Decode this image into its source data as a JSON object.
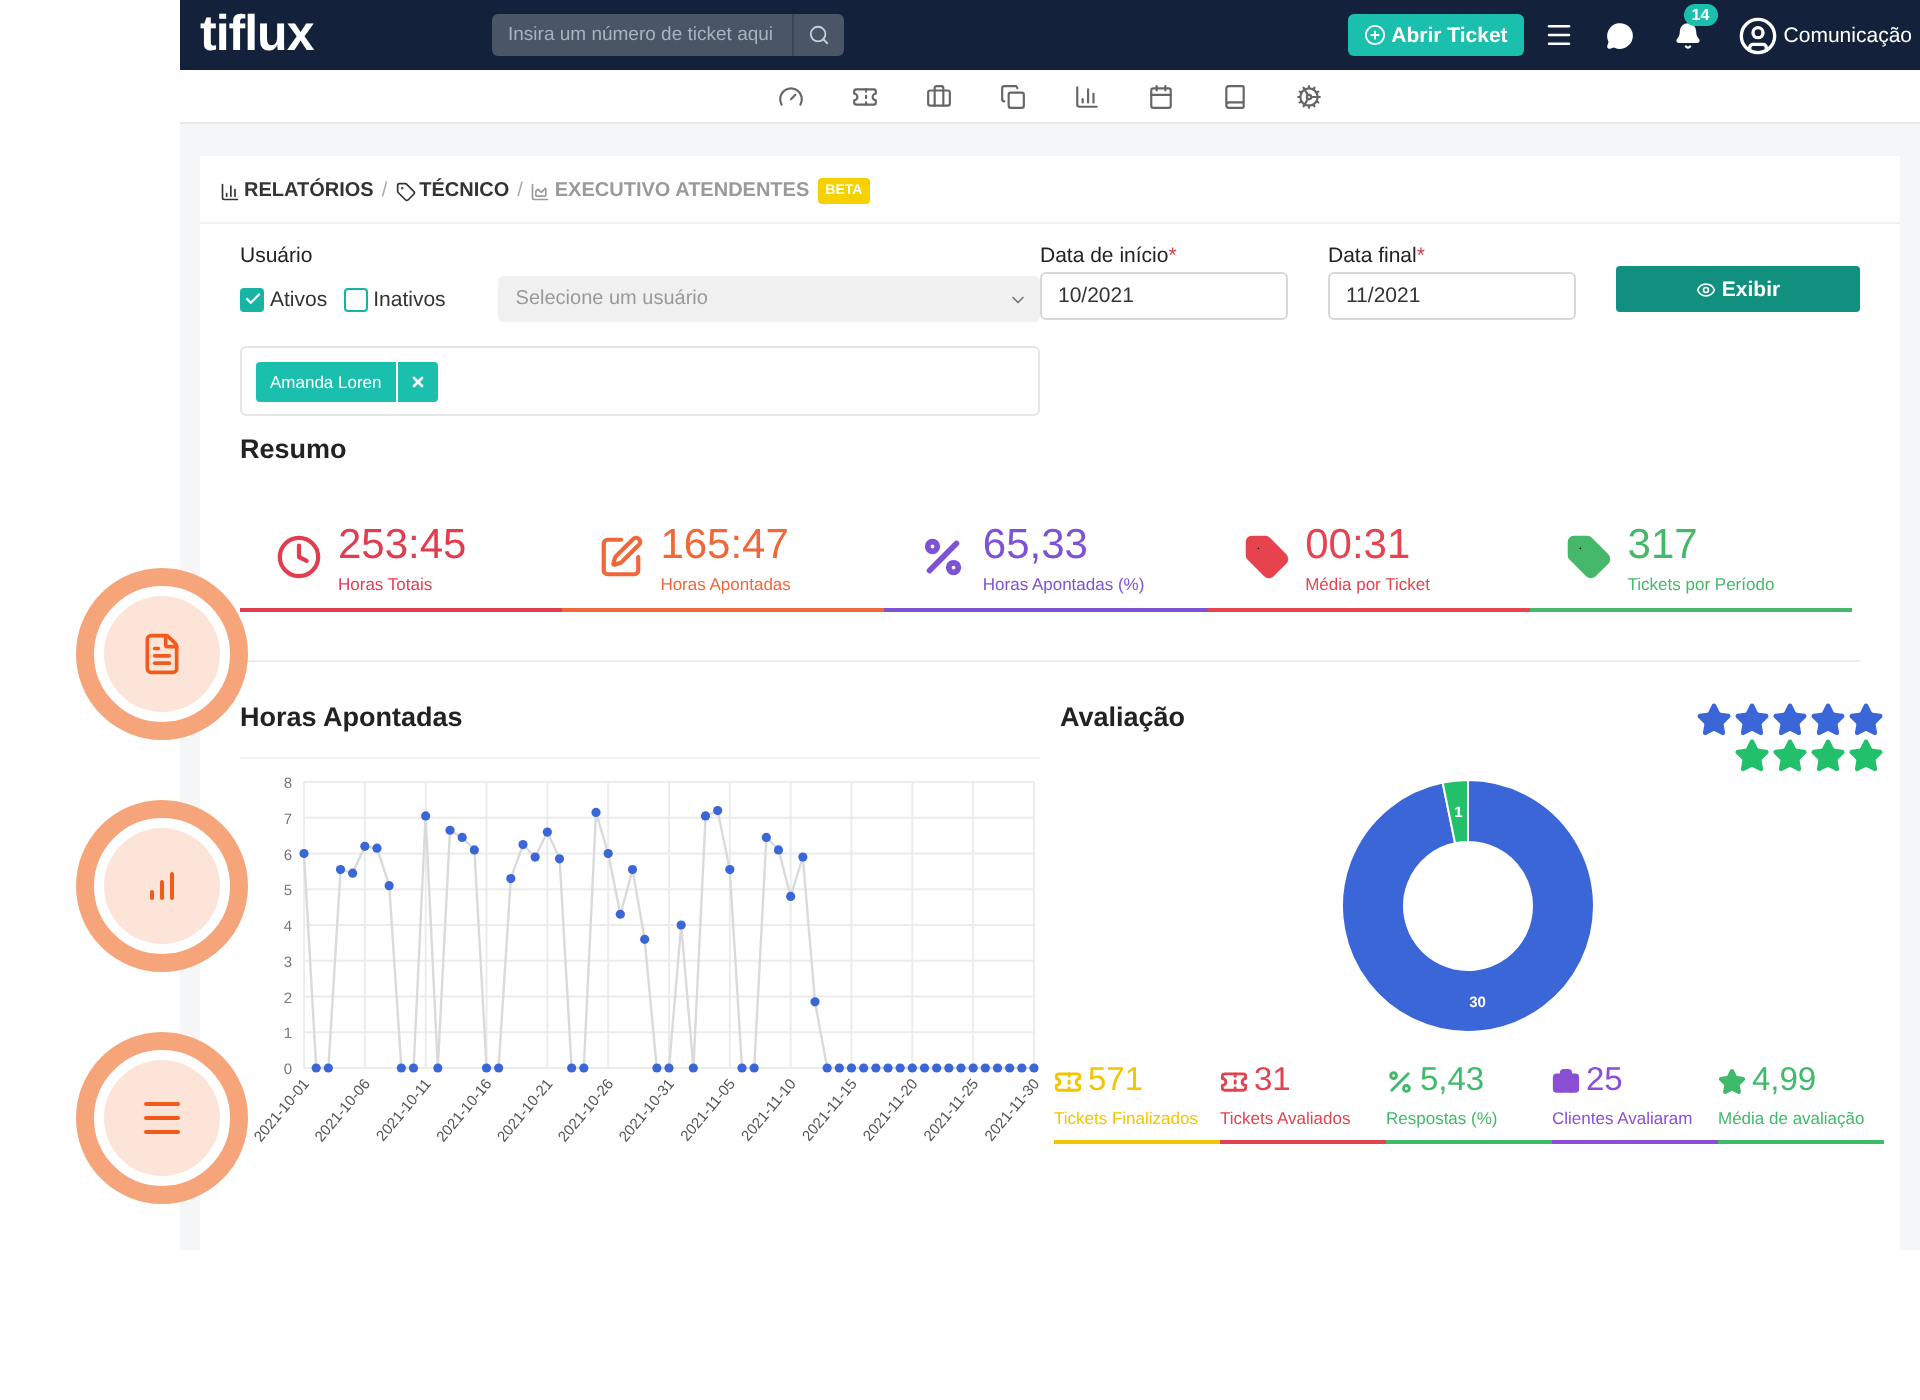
{
  "navbar": {
    "logo": "tiflux",
    "search": {
      "placeholder": "Insira um número de ticket aqui"
    },
    "new_ticket_button": "Abrir Ticket",
    "notifications_badge": "14",
    "user": "Comunicação"
  },
  "breadcrumb": [
    {
      "label": "RELATÓRIOS",
      "selected": false,
      "separator": "/"
    },
    {
      "label": "TÉCNICO",
      "selected": false,
      "separator": "/"
    },
    {
      "label": "EXECUTIVO ATENDENTES",
      "selected": true
    }
  ],
  "breadcrumb_badge": "BETA",
  "filters": {
    "user_label": "Usuário",
    "checkboxes": [
      {
        "label": "Ativos",
        "checked": true
      },
      {
        "label": "Inativos",
        "checked": false
      }
    ],
    "user_select": {
      "placeholder": "Selecione um usuário"
    },
    "start_label": "Data de início",
    "start_value": "10/2021",
    "end_label": "Data final",
    "end_value": "11/2021",
    "required_mark": "*",
    "show_button": "Exibir",
    "selected_users": [
      "Amanda Loren"
    ]
  },
  "summary_title": "Resumo",
  "summary": [
    {
      "value": "253:45",
      "label": "Horas Totais",
      "color": "#e23d4f"
    },
    {
      "value": "165:47",
      "label": "Horas Apontadas",
      "color": "#f0673a"
    },
    {
      "value": "65,33",
      "label": "Horas Apontadas (%)",
      "color": "#7e52d6"
    },
    {
      "value": "00:31",
      "label": "Média por Ticket",
      "color": "#e6434f"
    },
    {
      "value": "317",
      "label": "Tickets por Período",
      "color": "#45b86a"
    }
  ],
  "hours_chart": {
    "title": "Horas Apontadas",
    "chart_data": {
      "type": "line",
      "grid": true,
      "categories": [
        "2021-10-01",
        null,
        null,
        null,
        null,
        "2021-10-06",
        null,
        null,
        null,
        null,
        "2021-10-11",
        null,
        null,
        null,
        null,
        "2021-10-16",
        null,
        null,
        null,
        null,
        "2021-10-21",
        null,
        null,
        null,
        null,
        "2021-10-26",
        null,
        null,
        null,
        null,
        "2021-10-31",
        null,
        null,
        null,
        null,
        "2021-11-05",
        null,
        null,
        null,
        null,
        "2021-11-10",
        null,
        null,
        null,
        null,
        "2021-11-15",
        null,
        null,
        null,
        null,
        "2021-11-20",
        null,
        null,
        null,
        null,
        "2021-11-25",
        null,
        null,
        null,
        null,
        "2021-11-30"
      ],
      "series": [
        {
          "color": "#3a66d8",
          "marker": "circle",
          "values": [
            6,
            0,
            0,
            5.55,
            5.45,
            6.2,
            6.15,
            5.1,
            0,
            0,
            7.05,
            0,
            6.65,
            6.45,
            6.1,
            0,
            0,
            5.3,
            6.25,
            5.9,
            6.6,
            5.85,
            0,
            0,
            7.15,
            6,
            4.3,
            5.55,
            3.6,
            0,
            0,
            4,
            0,
            7.05,
            7.2,
            5.55,
            0,
            0,
            6.45,
            6.1,
            4.8,
            5.9,
            1.85,
            0,
            0,
            0,
            0,
            0,
            0,
            0,
            0,
            0,
            0,
            0,
            0,
            0,
            0,
            0,
            0,
            0,
            0
          ]
        }
      ],
      "ylim": [
        0,
        8
      ],
      "yticks": [
        0,
        1,
        2,
        3,
        4,
        5,
        6,
        7,
        8
      ]
    }
  },
  "rating": {
    "title": "Avaliação",
    "star_rows": [
      {
        "stars": 5,
        "color": "#3a66d8"
      },
      {
        "stars": 4,
        "color": "#22c06b"
      }
    ],
    "chart_data": {
      "type": "donut",
      "series": [
        {
          "values": [
            30,
            1
          ]
        }
      ],
      "colors": [
        "#3a66d8",
        "#22c06b"
      ],
      "data_labels": true
    }
  },
  "rating_stats": [
    {
      "value": "571",
      "label": "Tickets Finalizados",
      "color": "#f5c400"
    },
    {
      "value": "31",
      "label": "Tickets Avaliados",
      "color": "#e3424f"
    },
    {
      "value": "5,43",
      "label": "Respostas (%)",
      "color": "#3fba6a"
    },
    {
      "value": "25",
      "label": "Clientes Avaliaram",
      "color": "#8a4fd4"
    },
    {
      "value": "4,99",
      "label": "Média de avaliação",
      "color": "#3fba6a"
    }
  ]
}
